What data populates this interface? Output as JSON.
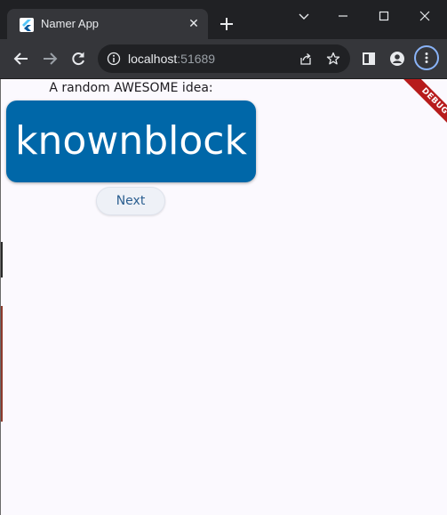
{
  "browser": {
    "tab_title": "Namer App",
    "tab_icon": "flutter-icon",
    "url_host": "localhost",
    "url_port": ":51689"
  },
  "app": {
    "prompt": "A random AWESOME idea:",
    "word_pair": "knownblock",
    "next_label": "Next",
    "debug_label": "DEBUG"
  },
  "colors": {
    "card": "#0067a8",
    "background": "#fbf9fe",
    "debug_banner": "#b71c1c"
  }
}
